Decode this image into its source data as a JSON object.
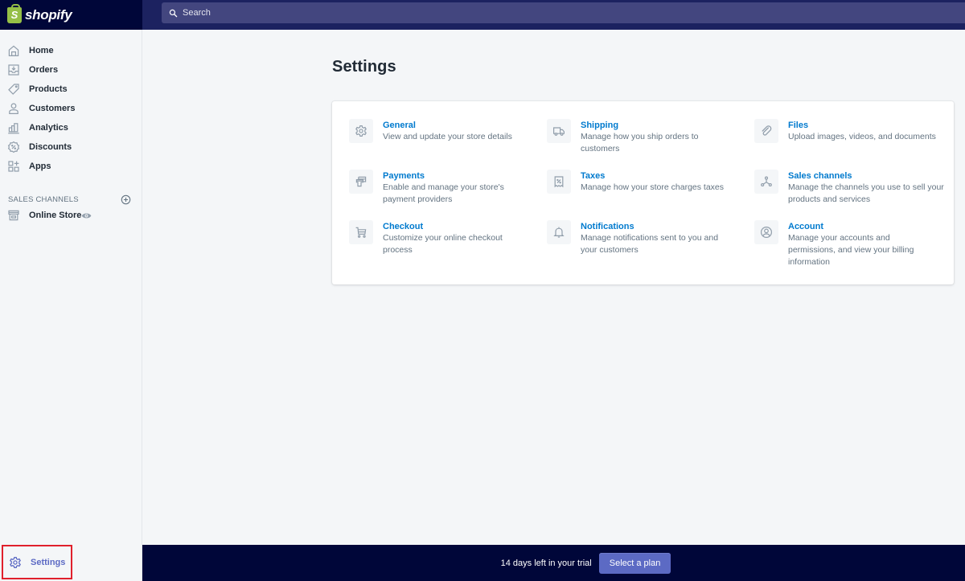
{
  "topbar": {
    "logo_text": "shopify",
    "logo_mark": "S",
    "search_placeholder": "Search"
  },
  "sidebar": {
    "items": [
      {
        "label": "Home",
        "icon": "home-icon"
      },
      {
        "label": "Orders",
        "icon": "orders-icon"
      },
      {
        "label": "Products",
        "icon": "tag-icon"
      },
      {
        "label": "Customers",
        "icon": "person-icon"
      },
      {
        "label": "Analytics",
        "icon": "bar-chart-icon"
      },
      {
        "label": "Discounts",
        "icon": "discount-icon"
      },
      {
        "label": "Apps",
        "icon": "apps-icon"
      }
    ],
    "sales_channels_heading": "SALES CHANNELS",
    "sales_channels": [
      {
        "label": "Online Store",
        "icon": "store-icon"
      }
    ],
    "settings_label": "Settings"
  },
  "main": {
    "title": "Settings",
    "items": [
      {
        "title": "General",
        "description": "View and update your store details",
        "icon": "gear-icon"
      },
      {
        "title": "Shipping",
        "description": "Manage how you ship orders to customers",
        "icon": "truck-icon"
      },
      {
        "title": "Files",
        "description": "Upload images, videos, and documents",
        "icon": "paperclip-icon"
      },
      {
        "title": "Payments",
        "description": "Enable and manage your store's payment providers",
        "icon": "payments-icon"
      },
      {
        "title": "Taxes",
        "description": "Manage how your store charges taxes",
        "icon": "tax-receipt-icon"
      },
      {
        "title": "Sales channels",
        "description": "Manage the channels you use to sell your products and services",
        "icon": "channels-icon"
      },
      {
        "title": "Checkout",
        "description": "Customize your online checkout process",
        "icon": "cart-icon"
      },
      {
        "title": "Notifications",
        "description": "Manage notifications sent to you and your customers",
        "icon": "bell-icon"
      },
      {
        "title": "Account",
        "description": "Manage your accounts and permissions, and view your billing information",
        "icon": "account-icon"
      }
    ]
  },
  "trial_bar": {
    "message": "14 days left in your trial",
    "button_label": "Select a plan"
  },
  "colors": {
    "topbar": "#1c2260",
    "logo_area": "#000639",
    "accent": "#5c6ac4",
    "link": "#007ace",
    "highlight_border": "#e0202c"
  }
}
